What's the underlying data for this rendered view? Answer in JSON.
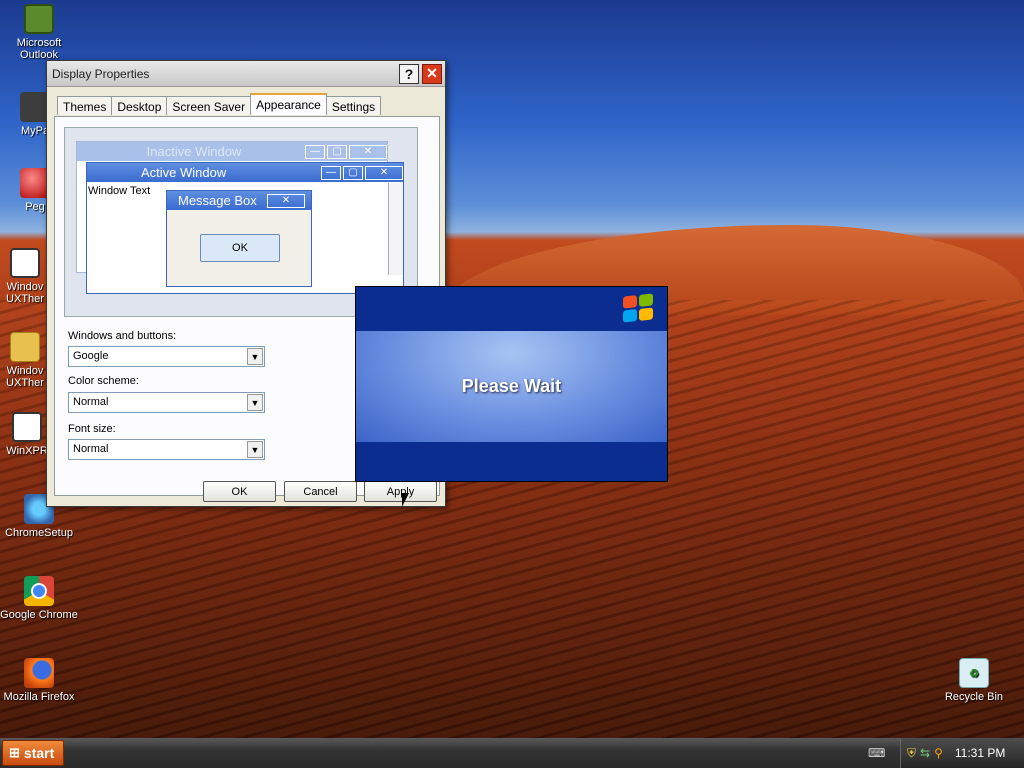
{
  "desktop": {
    "icons": [
      {
        "label": "Microsoft Outlook"
      },
      {
        "label": "MyPa"
      },
      {
        "label": "Peg"
      },
      {
        "label": "Windov UXTher"
      },
      {
        "label": "Windov UXTher"
      },
      {
        "label": "WinXPR"
      },
      {
        "label": "ChromeSetup"
      },
      {
        "label": "Google Chrome"
      },
      {
        "label": "Mozilla Firefox"
      },
      {
        "label": "Recycle Bin"
      }
    ]
  },
  "dialog": {
    "title": "Display Properties",
    "help_label": "?",
    "close_label": "✕",
    "tabs": [
      "Themes",
      "Desktop",
      "Screen Saver",
      "Appearance",
      "Settings"
    ],
    "active_tab": "Appearance",
    "preview": {
      "inactive_title": "Inactive Window",
      "active_title": "Active Window",
      "window_text": "Window Text",
      "msgbox_title": "Message Box",
      "msgbox_ok": "OK"
    },
    "windows_buttons_label": "Windows and buttons:",
    "windows_buttons_value": "Google",
    "color_scheme_label": "Color scheme:",
    "color_scheme_value": "Normal",
    "font_size_label": "Font size:",
    "font_size_value": "Normal",
    "ok_label": "OK",
    "cancel_label": "Cancel",
    "apply_label": "Apply"
  },
  "wait": {
    "message": "Please Wait"
  },
  "taskbar": {
    "start_label": "start",
    "clock": "11:31 PM"
  },
  "colors": {
    "dialog_bg": "#ece9d8",
    "wait_bg": "#0a2d8f",
    "start": "#d85a18"
  }
}
